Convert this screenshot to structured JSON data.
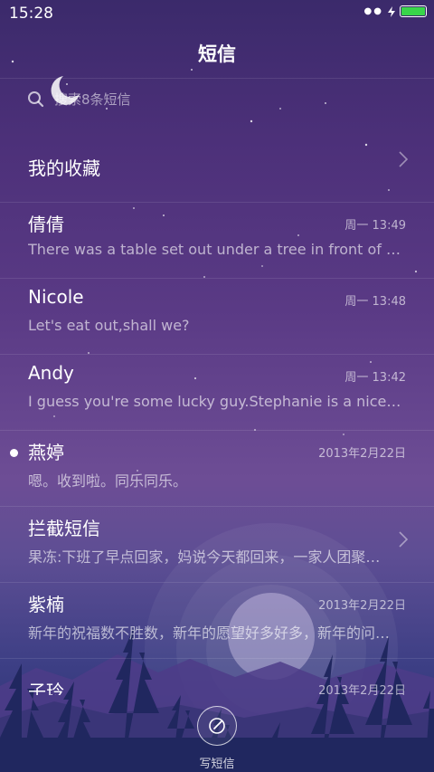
{
  "status_bar": {
    "time": "15:28",
    "battery_color": "#39d54a"
  },
  "header": {
    "title": "短信"
  },
  "search": {
    "placeholder": "搜索8条短信"
  },
  "conversations": [
    {
      "name": "我的收藏",
      "preview": "",
      "time": "",
      "chevron": true
    },
    {
      "name": "倩倩",
      "preview": "There was a table set out under a tree in front of the house.",
      "time": "周一 13:49"
    },
    {
      "name": "Nicole",
      "preview": "Let's eat out,shall we?",
      "time": "周一 13:48"
    },
    {
      "name": "Andy",
      "preview": "I guess you're some lucky guy.Stephanie is a nice girl.",
      "time": "周一 13:42"
    },
    {
      "name": "燕婷",
      "preview": "嗯。收到啦。同乐同乐。",
      "time": "2013年2月22日",
      "unread": true
    },
    {
      "name": "拦截短信",
      "preview": "果冻:下班了早点回家，妈说今天都回来，一家人团聚过年",
      "time": "",
      "chevron": true
    },
    {
      "name": "紫楠",
      "preview": "新年的祝福数不胜数，新年的愿望好多好多，新年的问候来啦",
      "time": "2013年2月22日"
    },
    {
      "name": "子玲",
      "preview": "",
      "time": "2013年2月22日"
    }
  ],
  "compose": {
    "label": "写短信"
  },
  "icons": {
    "search": "search-icon",
    "chevron": "chevron-right-icon",
    "compose": "compose-pen-icon",
    "battery": "battery-icon",
    "signal": "signal-icon",
    "charging": "charging-icon",
    "moon": "moon-icon"
  }
}
